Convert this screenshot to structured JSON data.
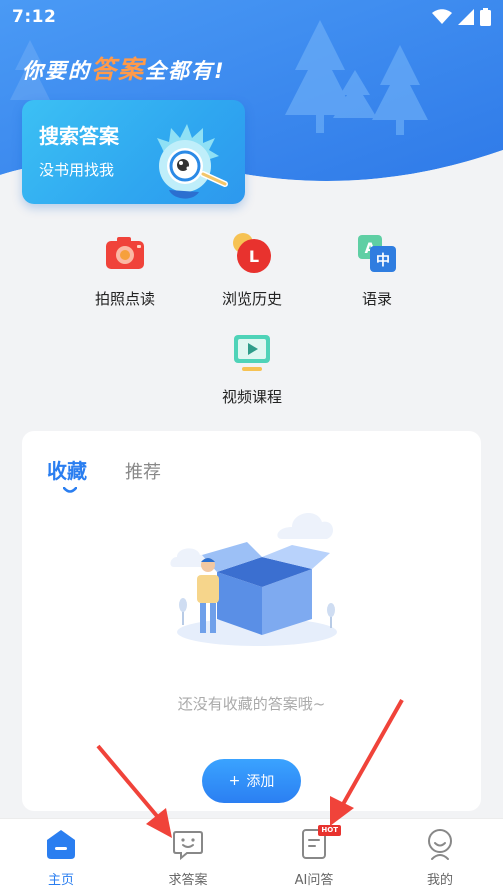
{
  "status_bar": {
    "time": "7:12",
    "icons": [
      "wifi-icon",
      "signal-icon",
      "battery-icon"
    ]
  },
  "hero": {
    "slogan_pre": "你要的",
    "slogan_accent": "答案",
    "slogan_post": "全都有!",
    "search_card": {
      "title": "搜索答案",
      "subtitle": "没书用找我"
    }
  },
  "features": [
    {
      "id": "photo",
      "label": "拍照点读",
      "icon": "camera-icon"
    },
    {
      "id": "history",
      "label": "浏览历史",
      "icon": "history-icon"
    },
    {
      "id": "phrases",
      "label": "语录",
      "icon": "translate-icon"
    },
    {
      "id": "video",
      "label": "视频课程",
      "icon": "video-icon"
    }
  ],
  "favorites": {
    "tabs": [
      {
        "label": "收藏",
        "active": true
      },
      {
        "label": "推荐",
        "active": false
      }
    ],
    "empty_text": "还没有收藏的答案哦~",
    "add_button": {
      "icon": "+",
      "label": "添加"
    }
  },
  "tabbar": [
    {
      "label": "主页",
      "icon": "home-icon",
      "active": true
    },
    {
      "label": "求答案",
      "icon": "chat-face-icon",
      "active": false
    },
    {
      "label": "AI问答",
      "icon": "document-icon",
      "active": false,
      "badge": "HOT"
    },
    {
      "label": "我的",
      "icon": "profile-icon",
      "active": false
    }
  ],
  "colors": {
    "accent": "#2a7ef0",
    "hero_blue": "#3d8cf3",
    "slogan_accent": "#ff9a4a",
    "hot_badge": "#e8322e",
    "annotation_arrow": "#f0433a"
  }
}
